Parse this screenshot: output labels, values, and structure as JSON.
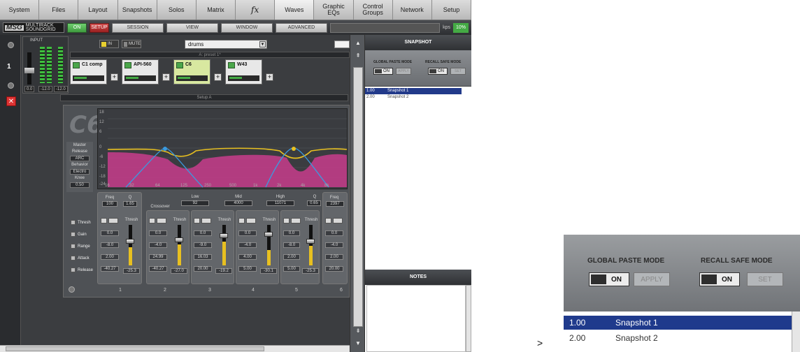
{
  "nav": {
    "tabs": [
      {
        "label": "System"
      },
      {
        "label": "Files"
      },
      {
        "label": "Layout"
      },
      {
        "label": "Snapshots"
      },
      {
        "label": "Solos"
      },
      {
        "label": "Matrix"
      },
      {
        "label": "fx"
      },
      {
        "label": "Waves"
      },
      {
        "label": "Graphic EQs"
      },
      {
        "label": "Control Groups"
      },
      {
        "label": "Network"
      },
      {
        "label": "Setup"
      }
    ],
    "active": "Waves"
  },
  "toolbar": {
    "logo_big": "MSG",
    "logo_small": "MULTIRACK SOUNDGRID",
    "on_label": "ON",
    "setup_label": "SETUP",
    "session_label": "SESSION",
    "view_label": "VIEW",
    "window_label": "WINDOW",
    "advanced_label": "ADVANCED",
    "kbps": "kps",
    "percent": "10%"
  },
  "rack": {
    "channel_number": "1",
    "input_label": "INPUT",
    "close_glyph": "✕",
    "readouts": [
      "0.0",
      "-12.0",
      "-12.0"
    ],
    "in_label": "IN",
    "mute_label": "MUTE",
    "preset_name": "drums",
    "preset_bar": "A: preset 1*",
    "setup_bar": "Setup A",
    "plugins": [
      {
        "name": "C1 comp"
      },
      {
        "name": "API-560"
      },
      {
        "name": "C6"
      },
      {
        "name": "W43"
      }
    ],
    "plus_glyph": "+"
  },
  "c6": {
    "logo": "C6",
    "master_label": "Master",
    "release_label": "Release",
    "release_value": "ARC",
    "behavior_label": "Behavior",
    "behavior_value": "Electro",
    "knee_label": "Knee",
    "knee_value": "0.50",
    "y_ticks": [
      "18",
      "12",
      "6",
      "0",
      "-6",
      "-12",
      "-18",
      "-24"
    ],
    "x_ticks": [
      "16",
      "32",
      "64",
      "125",
      "250",
      "500",
      "1k",
      "2k",
      "4k",
      "8k"
    ],
    "row_labels": [
      "Thresh",
      "Gain",
      "Range",
      "Attack",
      "Release"
    ],
    "crossover_label": "Crossover",
    "crossovers": [
      {
        "head": "Low",
        "value": "92"
      },
      {
        "head": "Mid",
        "value": "4000"
      },
      {
        "head": "High",
        "value": "11071"
      }
    ],
    "band1": {
      "freq_label": "Freq",
      "freq": "100",
      "q_label": "Q",
      "q": "1.65"
    },
    "band_right": {
      "q_label": "Q",
      "q": "0.65",
      "freq_label": "Freq",
      "freq": "2397"
    },
    "thresh_label": "Thresh",
    "bands": [
      {
        "num": "1",
        "vals": [
          "0.0",
          "-8.0",
          "2.00",
          "-40.27"
        ],
        "level": "-25.3"
      },
      {
        "num": "2",
        "vals": [
          "0.0",
          "-4.0",
          "24.99",
          "-40.27"
        ],
        "level": "-27.0"
      },
      {
        "num": "3",
        "vals": [
          "0.0",
          "-9.0",
          "16.03",
          "20.00"
        ],
        "level": "-19.2"
      },
      {
        "num": "4",
        "vals": [
          "0.0",
          "-4.0",
          "4.00",
          "5.00"
        ],
        "level": "-30.1"
      },
      {
        "num": "5",
        "vals": [
          "0.0",
          "-8.0",
          "2.00",
          "5.00"
        ],
        "level": "-25.3"
      },
      {
        "num": "6",
        "vals": [
          "0.0",
          "-4.0",
          "2.00",
          "20.00"
        ],
        "level": ""
      }
    ]
  },
  "snapshot": {
    "title": "SNAPSHOT",
    "global_paste_label": "GLOBAL PASTE MODE",
    "recall_safe_label": "RECALL SAFE MODE",
    "on_label": "ON",
    "apply_label": "APPLY",
    "set_label": "SET",
    "items": [
      {
        "num": "1.00",
        "name": "Snapshot 1",
        "selected": true
      },
      {
        "num": "2.00",
        "name": "Snapshot 2",
        "selected": false
      }
    ],
    "notes_title": "NOTES"
  },
  "separator": ">",
  "colors": {
    "selection": "#223a8a",
    "on_green": "#44aa44",
    "setup_red": "#b22222",
    "eq_magenta": "#c83c8c",
    "curve_yellow": "#e8c020",
    "curve_blue": "#3a9be0"
  }
}
